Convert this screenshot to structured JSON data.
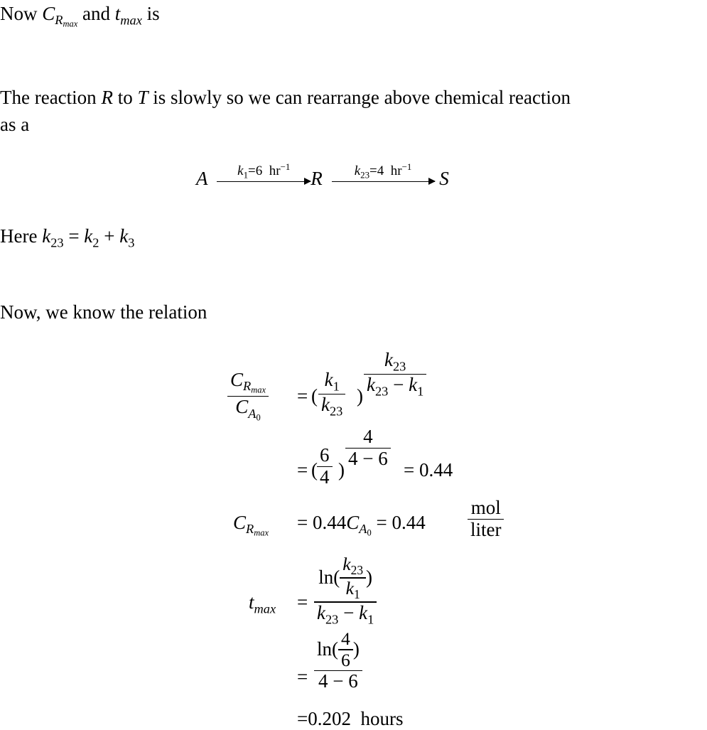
{
  "document": {
    "intro": {
      "prefix": "Now",
      "c_r_max": "C",
      "c_r_max_sub": "R",
      "c_r_max_subsub": "max",
      "and": "and",
      "t": "t",
      "t_sub": "max",
      "suffix": "is"
    },
    "paragraph1": {
      "line1_a": "The reaction",
      "R": "R",
      "line1_b": "to",
      "T": "T",
      "line1_c": "is slowly so we can rearrange above chemical reaction",
      "line2": "as a"
    },
    "reaction": {
      "A": "A",
      "R": "R",
      "S": "S",
      "arrow1_k": "k",
      "arrow1_k_sub": "1",
      "arrow1_value": "=6",
      "arrow1_unit": "hr",
      "arrow1_exp": "−1",
      "arrow2_k": "k",
      "arrow2_k_sub": "23",
      "arrow2_value": "=4",
      "arrow2_unit": "hr",
      "arrow2_exp": "−1"
    },
    "here": {
      "prefix": "Here",
      "k": "k",
      "lhs_sub": "23",
      "eq": " = ",
      "k2_sub": "2",
      "plus": " + ",
      "k3_sub": "3"
    },
    "relation_intro": "Now, we know the relation",
    "equations": {
      "eq1": {
        "lhs_num_C": "C",
        "lhs_num_sub": "R",
        "lhs_num_subsub": "max",
        "lhs_den_C": "C",
        "lhs_den_sub": "A",
        "lhs_den_subsub": "0",
        "equals": "=",
        "base_num_k": "k",
        "base_num_sub": "1",
        "base_den_k": "k",
        "base_den_sub": "23",
        "exp_num_k": "k",
        "exp_num_sub": "23",
        "exp_den_k1": "k",
        "exp_den_sub1": "23",
        "exp_den_minus": " − ",
        "exp_den_k2": "k",
        "exp_den_sub2": "1"
      },
      "eq2": {
        "equals": "=",
        "base_num": "6",
        "base_den": "4",
        "exp_num": "4",
        "exp_den": "4 − 6",
        "result": " = 0.44"
      },
      "eq3": {
        "lhs_C": "C",
        "lhs_sub": "R",
        "lhs_subsub": "max",
        "equals": "=",
        "value": "0.44",
        "C": "C",
        "C_sub": "A",
        "C_subsub": "0",
        "result": " = 0.44",
        "unit_num": "mol",
        "unit_den": "liter"
      },
      "eq4": {
        "lhs_t": "t",
        "lhs_sub": "max",
        "equals": "=",
        "ln": "ln(",
        "inner_num_k": "k",
        "inner_num_sub": "23",
        "inner_den_k": "k",
        "inner_den_sub": "1",
        "close": ")",
        "den_k1": "k",
        "den_sub1": "23",
        "den_minus": " − ",
        "den_k2": "k",
        "den_sub2": "1"
      },
      "eq5": {
        "equals": "=",
        "ln": "ln(",
        "inner_num": "4",
        "inner_den": "6",
        "close": ")",
        "den": "4 − 6"
      },
      "eq6": {
        "equals": "=",
        "value": "0.202",
        "unit": "hours"
      }
    }
  }
}
